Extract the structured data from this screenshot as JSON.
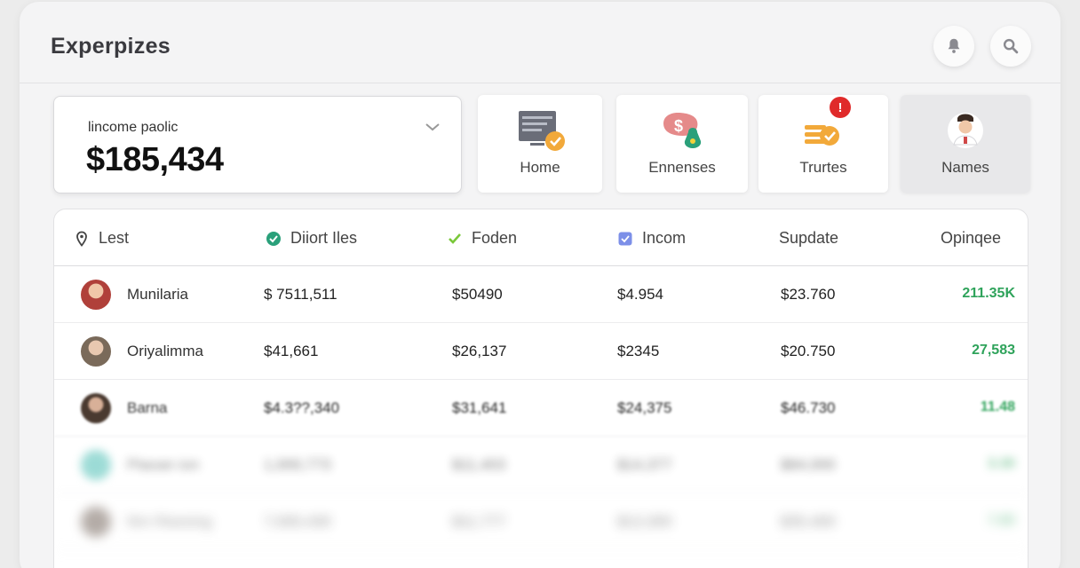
{
  "app": {
    "title": "Experpizes"
  },
  "header": {
    "notifications_icon": "bell-icon",
    "search_icon": "search-icon"
  },
  "summary": {
    "label": "lincome paolic",
    "value": "$185,434"
  },
  "tiles": [
    {
      "label": "Home",
      "icon": "monitor-check-icon"
    },
    {
      "label": "Ennenses",
      "icon": "money-bag-icon"
    },
    {
      "label": "Trurtes",
      "icon": "coins-icon",
      "badge": "!"
    },
    {
      "label": "Names",
      "icon": "person-avatar-icon"
    }
  ],
  "table": {
    "headers": [
      "Lest",
      "Diiort Iles",
      "Foden",
      "Incom",
      "Supdate",
      "Opinqee"
    ],
    "rows": [
      {
        "name": "Munilaria",
        "c1": "$ 7511,511",
        "c2": "$50490",
        "c3": "$4.954",
        "c4": "$23.760",
        "c5": "211.35K",
        "avatar": "#b0403a"
      },
      {
        "name": "Oriyalimma",
        "c1": "$41,661",
        "c2": "$26,137",
        "c3": "$2345",
        "c4": "$20.750",
        "c5": "27,583",
        "avatar": "#7a6a5a"
      },
      {
        "name": "Barna",
        "c1": "$4.3??,340",
        "c2": "$31,641",
        "c3": "$24,375",
        "c4": "$46.730",
        "c5": "11.48",
        "avatar": "#4a3a30"
      },
      {
        "name": "Ptaoan ion",
        "c1": "1,000,773",
        "c2": "$11,403",
        "c3": "$14,377",
        "c4": "$84,000",
        "c5": "3.30",
        "avatar": "#5cc4bb"
      },
      {
        "name": "Nrn Reeoing",
        "c1": "7,000,430",
        "c2": "$11,777",
        "c3": "$13,300",
        "c4": "$35,400",
        "c5": "7.80",
        "avatar": "#6a5a50"
      }
    ]
  },
  "colors": {
    "accent_green": "#2fa35b",
    "badge_red": "#e02a2a",
    "check_teal": "#2aa07a",
    "lime": "#7ac83a",
    "lavender": "#7c8fe8"
  }
}
